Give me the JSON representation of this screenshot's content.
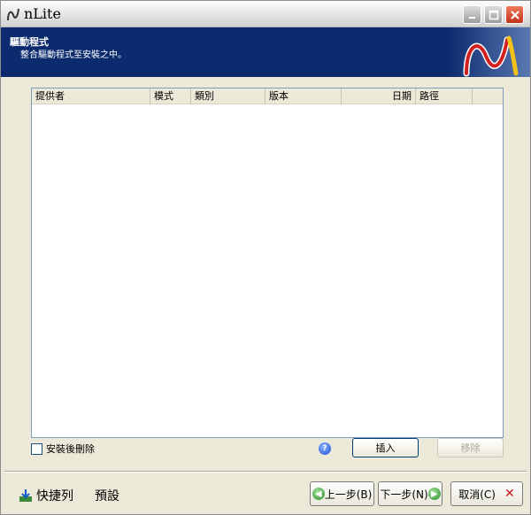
{
  "window": {
    "title": "nLite",
    "icons": {
      "app": "nlite-logo-icon",
      "minimize": "minimize-icon",
      "maximize": "maximize-icon",
      "close": "close-icon"
    },
    "colors": {
      "header_bg": "#0c2b6e",
      "close_btn": "#c2321a"
    }
  },
  "header": {
    "title": "驅動程式",
    "description": "整合驅動程式至安裝之中。"
  },
  "list": {
    "columns": [
      "提供者",
      "模式",
      "類別",
      "版本",
      "日期",
      "路徑",
      ""
    ],
    "rows": []
  },
  "options": {
    "delete_after_install_label": "安裝後刪除",
    "delete_after_install_checked": false
  },
  "buttons": {
    "insert": "插入",
    "remove": "移除",
    "back": "上一步(B)",
    "next": "下一步(N)",
    "cancel": "取消(C)"
  },
  "footer": {
    "quickbar": "快捷列",
    "presets": "預設"
  }
}
